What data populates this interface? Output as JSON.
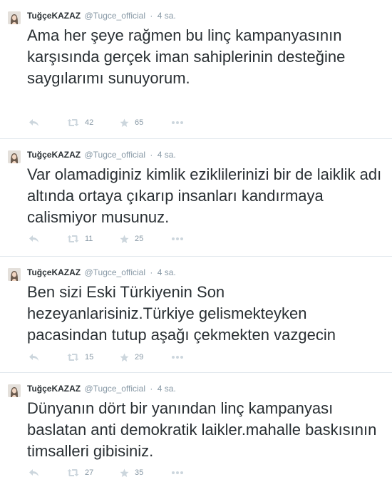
{
  "tweets": [
    {
      "fullname": "TuğçeKAZAZ",
      "username": "@Tugce_official",
      "separator": "·",
      "time": "4 sa.",
      "text": "Ama her şeye rağmen bu linç kampanyasının karşısında gerçek iman sahiplerinin desteğine saygılarımı sunuyorum.",
      "retweets": "42",
      "favorites": "65"
    },
    {
      "fullname": "TuğçeKAZAZ",
      "username": "@Tugce_official",
      "separator": "·",
      "time": "4 sa.",
      "text": "Var olamadiginiz kimlik eziklilerinizi bir de laiklik adı altında ortaya çıkarıp insanları kandırmaya calismiyor musunuz.",
      "retweets": "11",
      "favorites": "25"
    },
    {
      "fullname": "TuğçeKAZAZ",
      "username": "@Tugce_official",
      "separator": "·",
      "time": "4 sa.",
      "text": "Ben sizi Eski Türkiyenin Son hezeyanlarisiniz.Türkiye gelismekteyken pacasindan tutup aşağı çekmekten vazgecin",
      "retweets": "15",
      "favorites": "29"
    },
    {
      "fullname": "TuğçeKAZAZ",
      "username": "@Tugce_official",
      "separator": "·",
      "time": "4 sa.",
      "text": "Dünyanın dört bir yanından linç kampanyası baslatan anti demokratik laikler.mahalle baskısının timsalleri gibisiniz.",
      "retweets": "27",
      "favorites": "35"
    }
  ],
  "icons": {
    "reply": "reply-icon",
    "retweet": "retweet-icon",
    "favorite": "star-icon",
    "more": "more-icon",
    "avatar": "avatar"
  },
  "colors": {
    "text": "#292f33",
    "muted": "#8899a6",
    "icon": "#ccd6dd",
    "divider": "#e1e8ed"
  }
}
